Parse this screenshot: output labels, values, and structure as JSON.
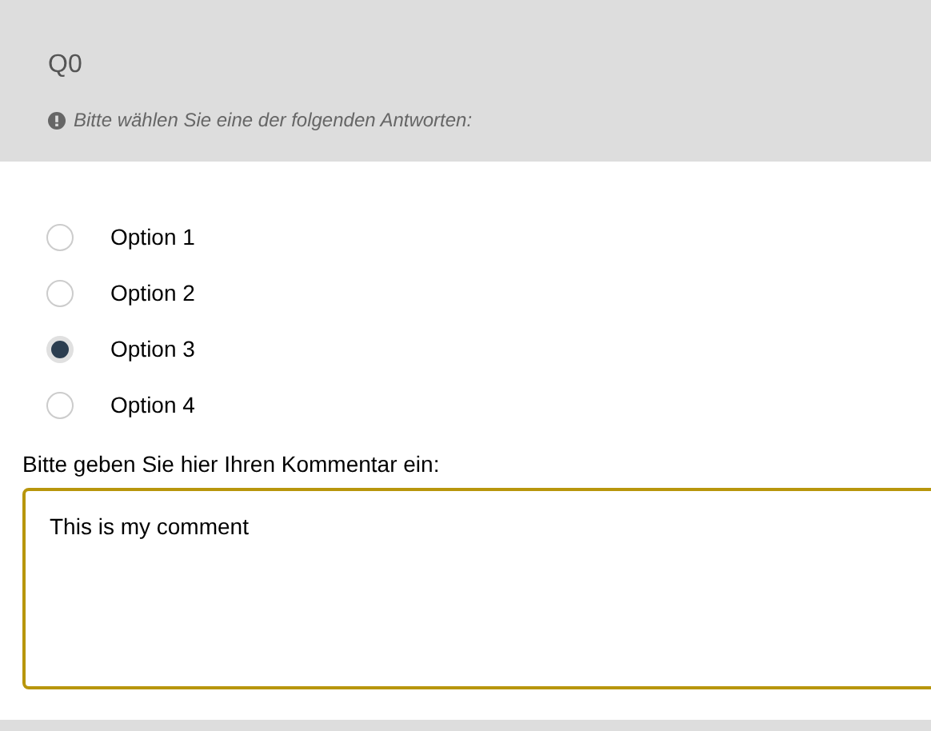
{
  "question": {
    "title": "Q0",
    "hint": "Bitte wählen Sie eine der folgenden Antworten:"
  },
  "options": [
    {
      "label": "Option 1",
      "selected": false
    },
    {
      "label": "Option 2",
      "selected": false
    },
    {
      "label": "Option 3",
      "selected": true
    },
    {
      "label": "Option 4",
      "selected": false
    }
  ],
  "comment": {
    "label": "Bitte geben Sie hier Ihren Kommentar ein:",
    "value": "This is my comment"
  }
}
